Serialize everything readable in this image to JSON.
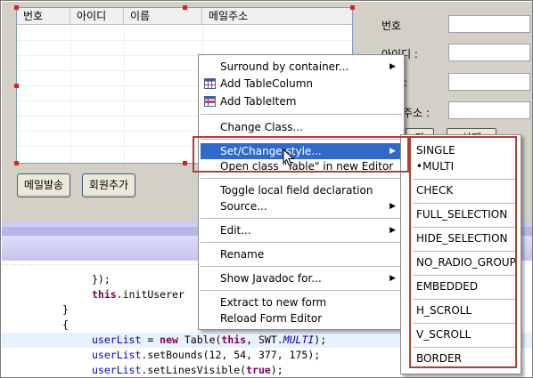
{
  "table": {
    "columns": [
      "번호",
      "아이디",
      "이름",
      "메일주소"
    ]
  },
  "form_buttons": {
    "mail": "메일발송",
    "add_member": "회원추가"
  },
  "right_panel": {
    "labels": [
      "번호",
      "아이디 :",
      ":",
      "주소 :"
    ],
    "buttons": [
      "가",
      "삭제"
    ]
  },
  "context_menu": {
    "items": [
      {
        "label": "Surround by container...",
        "submenu": true
      },
      {
        "label": "Add TableColumn",
        "icon": "table-column-icon"
      },
      {
        "label": "Add TableItem",
        "icon": "table-item-icon"
      },
      {
        "label": "Change Class..."
      },
      {
        "label": "Set/Change style...",
        "submenu": true,
        "active": true
      },
      {
        "label": "Open class \"Table\" in new Editor"
      },
      {
        "label": "Toggle local field declaration"
      },
      {
        "label": "Source...",
        "submenu": true
      },
      {
        "label": "Edit...",
        "submenu": true
      },
      {
        "label": "Rename"
      },
      {
        "label": "Show Javadoc for...",
        "submenu": true
      },
      {
        "label": "Extract to new form"
      },
      {
        "label": "Reload Form Editor"
      }
    ]
  },
  "style_submenu": {
    "items": [
      "SINGLE",
      "•MULTI",
      "CHECK",
      "FULL_SELECTION",
      "HIDE_SELECTION",
      "NO_RADIO_GROUP",
      "EMBEDDED",
      "H_SCROLL",
      "V_SCROLL",
      "BORDER"
    ]
  },
  "code": {
    "line1": "});",
    "line2_kw": "this",
    "line2_rest": ".initUserer",
    "line3": "}",
    "line4": "{",
    "line5_field": "userList",
    "line5_a": " = ",
    "line5_kw_new": "new",
    "line5_b": " Table(",
    "line5_kw_this": "this",
    "line5_c": ", SWT.",
    "line5_const": "MULTI",
    "line5_d": ");",
    "line6_field": "userList",
    "line6_rest": ".setBounds(12, 54, 377, 175);",
    "line7_field": "userList",
    "line7_a": ".setLinesVisible(",
    "line7_kw": "true",
    "line7_b": ");"
  },
  "colors": {
    "menu_highlight": "#3169c6",
    "annotation": "#b04030",
    "keyword": "#7f0055",
    "field": "#0000c0"
  }
}
